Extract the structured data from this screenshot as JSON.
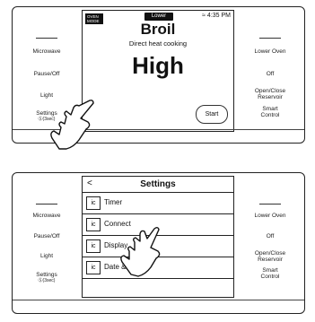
{
  "top_panel": {
    "left_buttons": [
      {
        "label": "Microwave"
      },
      {
        "label": "Pause/Off"
      },
      {
        "label": "Light"
      },
      {
        "label": "Settings",
        "sub": "(3sec)"
      }
    ],
    "right_buttons": [
      {
        "label": "Lower Oven"
      },
      {
        "label": "Off"
      },
      {
        "label": "Open/Close Reservoir"
      },
      {
        "label": "Smart Control"
      }
    ],
    "screen": {
      "mode_badge": "OVEN MODE",
      "oven_pill": "Lower",
      "time": "4:35 PM",
      "wifi_icon": "wifi-icon",
      "title": "Broil",
      "subtitle": "Direct heat cooking",
      "value": "High",
      "start_label": "Start"
    }
  },
  "bottom_panel": {
    "left_buttons": [
      {
        "label": "Microwave"
      },
      {
        "label": "Pause/Off"
      },
      {
        "label": "Light"
      },
      {
        "label": "Settings",
        "sub": "(3sec)"
      }
    ],
    "right_buttons": [
      {
        "label": "Lower Oven"
      },
      {
        "label": "Off"
      },
      {
        "label": "Open/Close Reservoir"
      },
      {
        "label": "Smart Control"
      }
    ],
    "screen": {
      "back": "<",
      "title": "Settings",
      "items": [
        {
          "icon": "ic",
          "label": "Timer"
        },
        {
          "icon": "ic",
          "label": "Connect"
        },
        {
          "icon": "ic",
          "label": "Display"
        },
        {
          "icon": "ic",
          "label": "Date & Time"
        }
      ]
    }
  }
}
